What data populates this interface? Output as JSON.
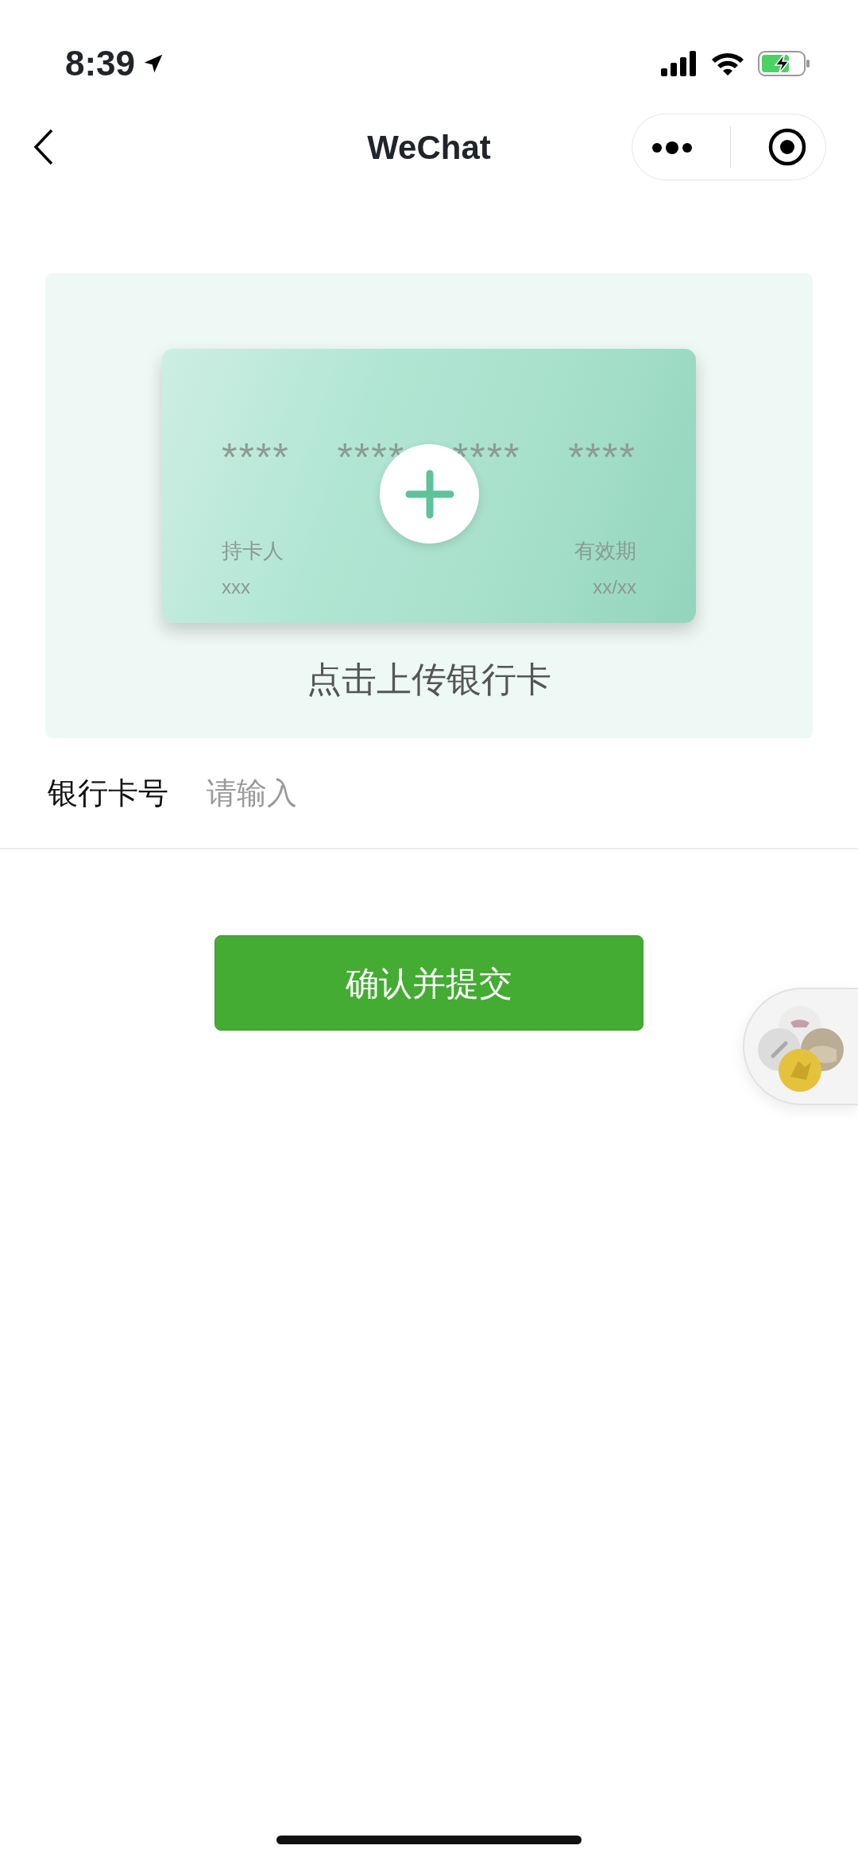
{
  "status_bar": {
    "time": "8:39"
  },
  "nav": {
    "title": "WeChat"
  },
  "upload": {
    "card_number_groups": [
      "****",
      "****",
      "****",
      "****"
    ],
    "holder_label": "持卡人",
    "holder_value": "xxx",
    "expiry_label": "有效期",
    "expiry_value": "xx/xx",
    "caption": "点击上传银行卡"
  },
  "form": {
    "fields": [
      {
        "label": "银行卡号",
        "placeholder": "请输入"
      }
    ]
  },
  "submit_button": "确认并提交"
}
